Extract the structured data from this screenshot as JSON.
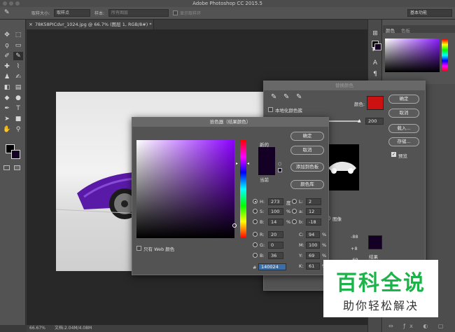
{
  "app": {
    "title": "Adobe Photoshop CC 2015.5"
  },
  "options_bar": {
    "sample_size_label": "取样大小:",
    "sample_size_value": "取样点",
    "sample_label": "样本:",
    "sample_value": "所有图层",
    "show_ring_label": "显示取样环",
    "workspace": "基本功能"
  },
  "document": {
    "tab": "78K58PICdvr_1024.jpg @ 66.7% (图层 1, RGB/8#) *",
    "close": "×"
  },
  "status": {
    "zoom": "66.67%",
    "doc": "文档:2.04M/4.08M"
  },
  "right_panel": {
    "color_tab": "颜色",
    "swatches_tab": "色板"
  },
  "replace_dialog": {
    "title": "替换颜色",
    "localized_label": "本地化颜色簇",
    "color_label": "颜色:",
    "fuzz_value": "200",
    "image_label": "图像",
    "ok": "确定",
    "cancel": "取消",
    "load": "载入...",
    "save": "存储...",
    "preview": "预览",
    "values": [
      "-88",
      "+8",
      "-69"
    ],
    "result_label": "结果"
  },
  "picker": {
    "title": "拾色器（结果颜色）",
    "new_label": "新的",
    "current_label": "当前",
    "ok": "确定",
    "cancel": "取消",
    "add_swatch": "添加到色板",
    "libraries": "颜色库",
    "web_only": "只有 Web 颜色",
    "hex": "140024",
    "hex_prefix": "#",
    "fields_left": [
      {
        "label": "H:",
        "value": "273",
        "unit": "度",
        "radio": true,
        "on": true
      },
      {
        "label": "S:",
        "value": "100",
        "unit": "%",
        "radio": true,
        "on": false
      },
      {
        "label": "B:",
        "value": "14",
        "unit": "%",
        "radio": true,
        "on": false
      },
      {
        "label": "R:",
        "value": "20",
        "unit": "",
        "radio": true,
        "on": false
      },
      {
        "label": "G:",
        "value": "0",
        "unit": "",
        "radio": true,
        "on": false
      },
      {
        "label": "B:",
        "value": "36",
        "unit": "",
        "radio": true,
        "on": false
      }
    ],
    "fields_right": [
      {
        "label": "L:",
        "value": "2",
        "unit": "",
        "radio": true
      },
      {
        "label": "a:",
        "value": "12",
        "unit": "",
        "radio": true
      },
      {
        "label": "b:",
        "value": "-18",
        "unit": "",
        "radio": true
      },
      {
        "label": "C:",
        "value": "94",
        "unit": "%",
        "radio": false
      },
      {
        "label": "M:",
        "value": "100",
        "unit": "%",
        "radio": false
      },
      {
        "label": "Y:",
        "value": "69",
        "unit": "%",
        "radio": false
      },
      {
        "label": "K:",
        "value": "61",
        "unit": "%",
        "radio": false
      }
    ]
  },
  "watermark": {
    "title": "百科全说",
    "subtitle": "助你轻松解决"
  },
  "colors": {
    "picked": "#140024",
    "replace_swatch": "#cc1111",
    "panel": "#535353"
  }
}
